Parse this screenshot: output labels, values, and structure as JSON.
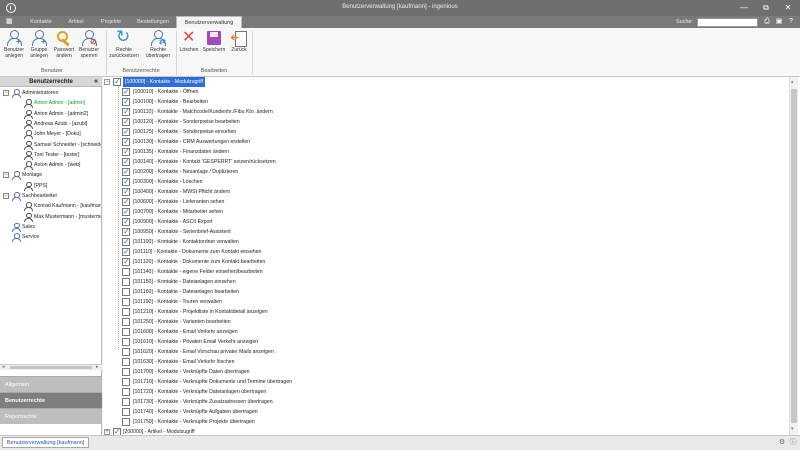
{
  "window": {
    "title": "Benutzerverwaltung [kaufmann] - ingenious",
    "controls": [
      "—",
      "⧉",
      "✕"
    ]
  },
  "menubar": {
    "icon": "grid-icon",
    "tabs": [
      {
        "label": "Kontakte",
        "active": false
      },
      {
        "label": "Artikel",
        "active": false
      },
      {
        "label": "Projekte",
        "active": false
      },
      {
        "label": "Bestellungen",
        "active": false
      },
      {
        "label": "Benutzerverwaltung",
        "active": true
      }
    ],
    "search_label": "Suche:",
    "search_value": "",
    "right_icons": [
      "print-icon",
      "layout-icon",
      "help-icon"
    ],
    "right_glyphs": [
      "⎙",
      "▣",
      "?"
    ]
  },
  "ribbon": {
    "groups": [
      {
        "label": "Benutzer",
        "buttons": [
          {
            "label1": "Benutzer",
            "label2": "anlegen",
            "icon": "user-add-icon"
          },
          {
            "label1": "Gruppe",
            "label2": "anlegen",
            "icon": "group-add-icon"
          },
          {
            "label1": "Passwort",
            "label2": "ändern",
            "icon": "key-icon"
          },
          {
            "label1": "Benutzer",
            "label2": "sperren",
            "icon": "user-lock-icon"
          }
        ]
      },
      {
        "label": "Benutzerrechte",
        "buttons": [
          {
            "label1": "Rechte",
            "label2": "zurücksetzen",
            "icon": "refresh-user-icon"
          },
          {
            "label1": "Rechte",
            "label2": "übertragen",
            "icon": "transfer-user-icon"
          }
        ]
      },
      {
        "label": "Bearbeiten",
        "buttons": [
          {
            "label1": "Löschen",
            "label2": "",
            "icon": "delete-icon"
          },
          {
            "label1": "Speichern",
            "label2": "",
            "icon": "save-icon"
          },
          {
            "label1": "Zurück",
            "label2": "",
            "icon": "back-icon"
          }
        ]
      }
    ]
  },
  "left_panel": {
    "header": "Benutzerrechte",
    "collapse_glyph": "«",
    "tree": [
      {
        "label": "Administratoren",
        "level": 0,
        "toggle": "−",
        "type": "group",
        "green": false
      },
      {
        "label": "Anton Admin - [admin]",
        "level": 1,
        "type": "user",
        "green": true
      },
      {
        "label": "Anton Admin - [admin2]",
        "level": 1,
        "type": "user",
        "green": false
      },
      {
        "label": "Andreas Azubi - [azubi]",
        "level": 1,
        "type": "user",
        "green": false
      },
      {
        "label": "John Meyer - [Doku]",
        "level": 1,
        "type": "user",
        "green": false
      },
      {
        "label": "Samuel Schneider - [schneider]",
        "level": 1,
        "type": "user",
        "green": false
      },
      {
        "label": "Toni Tester - [tester]",
        "level": 1,
        "type": "user",
        "green": false
      },
      {
        "label": "Anton Admin - [web]",
        "level": 1,
        "type": "user",
        "green": false
      },
      {
        "label": "Montage",
        "level": 0,
        "toggle": "−",
        "type": "group",
        "green": false
      },
      {
        "label": "[PPS]",
        "level": 1,
        "type": "user",
        "green": false
      },
      {
        "label": "Sachbearbeiter",
        "level": 0,
        "toggle": "−",
        "type": "group",
        "green": false
      },
      {
        "label": "Konrad Kaufmann - [kaufmann]",
        "level": 1,
        "type": "user",
        "green": false
      },
      {
        "label": "Max Mustermann - [mustermann]",
        "level": 1,
        "type": "user",
        "green": false
      },
      {
        "label": "Sales",
        "level": 0,
        "type": "group",
        "green": false
      },
      {
        "label": "Service",
        "level": 0,
        "type": "group",
        "green": false
      }
    ],
    "scroll_arrows": [
      "◂",
      "▸"
    ],
    "sections": [
      {
        "label": "Allgemein",
        "active": false
      },
      {
        "label": "Benutzerrechte",
        "active": true
      },
      {
        "label": "Reportrechte",
        "active": false
      }
    ]
  },
  "permissions": {
    "root": {
      "label": "[100000] - Kontakte - Modulzugriff",
      "checked": true,
      "toggle": "−"
    },
    "items": [
      {
        "label": "[100010] - Kontakte - Öffnen",
        "checked": true
      },
      {
        "label": "[100100] - Kontakte - Bearbeiten",
        "checked": true
      },
      {
        "label": "[100110] - Kontakte - Matchcode/Kundenhr./Fibu Kto. ändern",
        "checked": true
      },
      {
        "label": "[100120] - Kontakte - Sonderpreise bearbeiten",
        "checked": true
      },
      {
        "label": "[100125] - Kontakte - Sonderpreise einsehen",
        "checked": true
      },
      {
        "label": "[100130] - Kontakte - CRM Auswertungen erstellen",
        "checked": true
      },
      {
        "label": "[100135] - Kontakte - Finanzdaten ändern",
        "checked": true
      },
      {
        "label": "[100140] - Kontakte - Kontakt 'GESPERRT' setzen/rücksetzen",
        "checked": true
      },
      {
        "label": "[100200] - Kontakte - Neuanlage / Duplizieren",
        "checked": true
      },
      {
        "label": "[100300] - Kontakte - Löschen",
        "checked": true
      },
      {
        "label": "[100400] - Kontakte - MWSt Pflicht ändern",
        "checked": true
      },
      {
        "label": "[100600] - Kontakte - Lieferanten sehen",
        "checked": true
      },
      {
        "label": "[100700] - Kontakte - Mitarbeiter sehen",
        "checked": true
      },
      {
        "label": "[100900] - Kontakte - ASCII Export",
        "checked": true
      },
      {
        "label": "[100950] - Kontakte - Serienbrief-Assistent",
        "checked": true
      },
      {
        "label": "[101100] - Kontakte - Kontaktordner verwalten",
        "checked": true
      },
      {
        "label": "[101110] - Kontakte - Dokumente zum Kontakt einsehen",
        "checked": true
      },
      {
        "label": "[101120] - Kontakte - Dokumente zum Kontakt bearbeiten",
        "checked": true
      },
      {
        "label": "[101140] - Kontakte - eigene Felder einsehen/bearbeiten",
        "checked": false
      },
      {
        "label": "[101150] - Kontakte - Dateianlagen einsehen",
        "checked": false
      },
      {
        "label": "[101160] - Kontakte - Dateianlagen bearbeiten",
        "checked": false
      },
      {
        "label": "[101190] - Kontakte - Touren verwalten",
        "checked": false
      },
      {
        "label": "[101210] - Kontakte - Projektliste in Kontaktdetail anzeigen",
        "checked": false
      },
      {
        "label": "[101250] - Kontakte - Varianten bearbeiten",
        "checked": false
      },
      {
        "label": "[101600] - Kontakte - Email Verkehr anzeigen",
        "checked": false
      },
      {
        "label": "[101610] - Kontakte - Privaten Email Verkehr anzeigen",
        "checked": false
      },
      {
        "label": "[101620] - Kontakte - Email Vorschau privater Mails anzeigen",
        "checked": false
      },
      {
        "label": "[101630] - Kontakte - Email Verkehr löschen",
        "checked": false
      },
      {
        "label": "[101700] - Kontakte - Verknüpfte Daten übertragen",
        "checked": false
      },
      {
        "label": "[101710] - Kontakte - Verknüpfte Dokumente und Termine übertragen",
        "checked": false
      },
      {
        "label": "[101720] - Kontakte - Verknüpfte Dateianlagen übertragen",
        "checked": false
      },
      {
        "label": "[101730] - Kontakte - Verknüpfte Zusatzadressen übertragen",
        "checked": false
      },
      {
        "label": "[101740] - Kontakte - Verknüpfte Aufgaben übertragen",
        "checked": false
      },
      {
        "label": "[101750] - Kontakte - Verknüpfte Projekte übertragen",
        "checked": false
      }
    ],
    "next_root": {
      "label": "[200000] - Artikel - Modulzugriff",
      "checked": true,
      "toggle": "+"
    }
  },
  "scroll_arrows": [
    "▴",
    "▾"
  ],
  "bottom": {
    "tab_label": "Benutzerverwaltung [kaufmann]",
    "corner_icons": [
      "gear-icon",
      "info-icon"
    ],
    "corner_glyphs": [
      "⚙",
      "ⓘ"
    ]
  },
  "colors": {
    "selection": "#2f6fd1",
    "check": "#3a6fc8",
    "active_user": "#1f9a2e"
  }
}
